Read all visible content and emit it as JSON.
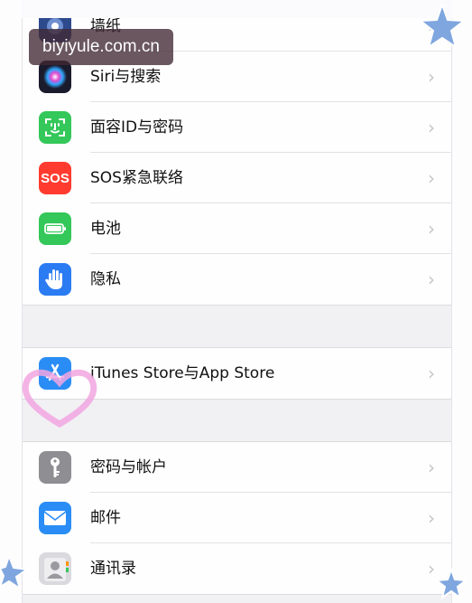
{
  "watermark": {
    "text": "biyiyule.com.cn"
  },
  "settings": {
    "group1": [
      {
        "label": "墙纸",
        "icon": "wallpaper-icon"
      },
      {
        "label": "Siri与搜索",
        "icon": "siri-icon"
      },
      {
        "label": "面容ID与密码",
        "icon": "face-id-icon"
      },
      {
        "label": "SOS紧急联络",
        "icon": "sos-icon"
      },
      {
        "label": "电池",
        "icon": "battery-icon"
      },
      {
        "label": "隐私",
        "icon": "privacy-hand-icon"
      }
    ],
    "group2": [
      {
        "label": "iTunes Store与App Store",
        "icon": "app-store-icon"
      }
    ],
    "group3": [
      {
        "label": "密码与帐户",
        "icon": "key-icon"
      },
      {
        "label": "邮件",
        "icon": "mail-icon"
      },
      {
        "label": "通讯录",
        "icon": "contacts-icon"
      }
    ],
    "chevron": "›",
    "sos_icon_text": "SOS"
  }
}
